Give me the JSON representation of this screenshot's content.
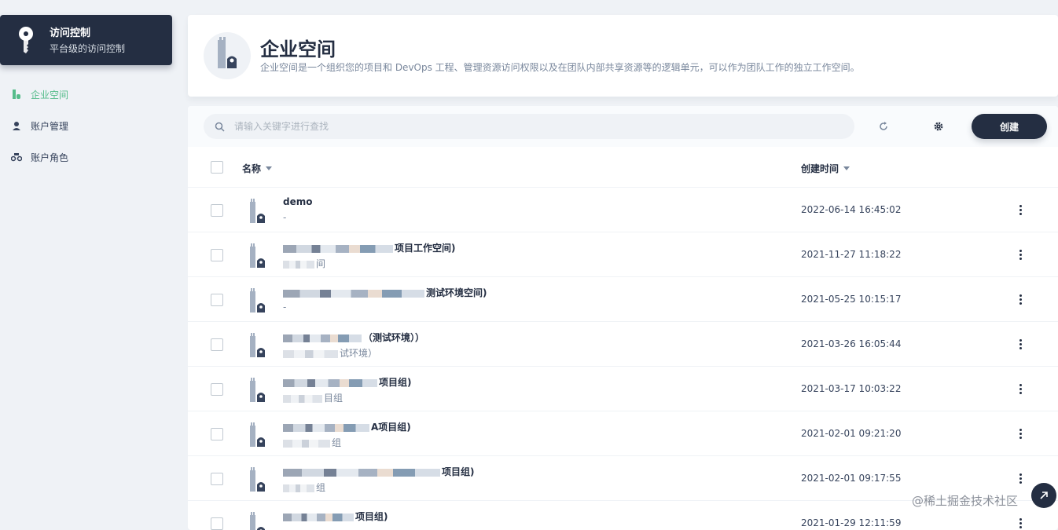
{
  "sidebar": {
    "title": "访问控制",
    "subtitle": "平台级的访问控制",
    "items": [
      {
        "label": "企业空间",
        "icon": "workspace-icon",
        "active": true
      },
      {
        "label": "账户管理",
        "icon": "user-icon",
        "active": false
      },
      {
        "label": "账户角色",
        "icon": "role-icon",
        "active": false
      }
    ]
  },
  "banner": {
    "title": "企业空间",
    "description": "企业空间是一个组织您的项目和 DevOps 工程、管理资源访问权限以及在团队内部共享资源等的逻辑单元，可以作为团队工作的独立工作空间。"
  },
  "toolbar": {
    "search_placeholder": "请输入关键字进行查找",
    "create_label": "创建"
  },
  "table": {
    "columns": {
      "name": "名称",
      "created": "创建时间"
    },
    "rows": [
      {
        "name": "demo",
        "name_suffix": "",
        "desc": "-",
        "desc_suffix": "",
        "time": "2022-06-14 16:45:02"
      },
      {
        "name": "",
        "name_suffix": "项目工作空间)",
        "desc": "",
        "desc_suffix": "间",
        "time": "2021-11-27 11:18:22"
      },
      {
        "name": "",
        "name_suffix": "测试环境空间)",
        "desc": "-",
        "desc_suffix": "",
        "time": "2021-05-25 10:15:17"
      },
      {
        "name": "",
        "name_suffix": "（测试环境））",
        "desc": "",
        "desc_suffix": "试环境）",
        "time": "2021-03-26 16:05:44"
      },
      {
        "name": "",
        "name_suffix": "项目组)",
        "desc": "",
        "desc_suffix": "目组",
        "time": "2021-03-17 10:03:22"
      },
      {
        "name": "",
        "name_suffix": "A项目组)",
        "desc": "",
        "desc_suffix": "组",
        "time": "2021-02-01 09:21:20"
      },
      {
        "name": "",
        "name_suffix": "项目组)",
        "desc": "",
        "desc_suffix": "组",
        "time": "2021-02-01 09:17:55"
      },
      {
        "name": "",
        "name_suffix": "项目组)",
        "desc": "",
        "desc_suffix": "",
        "time": "2021-01-29 12:11:59"
      }
    ]
  },
  "watermark": "@稀土掘金技术社区",
  "colors": {
    "accent": "#55bc8a",
    "dark": "#242e42",
    "muted": "#79879c",
    "background": "#eff2f6"
  }
}
